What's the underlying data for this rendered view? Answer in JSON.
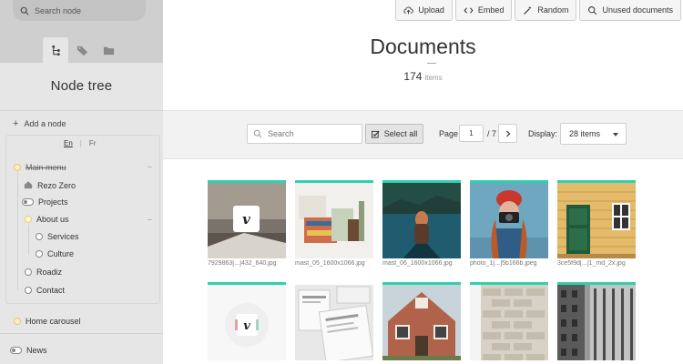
{
  "sidebar": {
    "search_placeholder": "Search node",
    "tabs": [
      {
        "icon": "node-tree-icon",
        "active": true
      },
      {
        "icon": "tag-icon",
        "active": false
      },
      {
        "icon": "folder-icon",
        "active": false
      }
    ],
    "title": "Node tree",
    "add_node": "Add a node",
    "languages": [
      "En",
      "Fr"
    ],
    "tree": {
      "main_menu": "Main menu",
      "rezo_zero": "Rezo Zero",
      "projects": "Projects",
      "about_us": "About us",
      "services": "Services",
      "culture": "Culture",
      "roadiz": "Roadiz",
      "contact": "Contact",
      "home_carousel": "Home carousel",
      "news": "News"
    }
  },
  "toolbar_top": {
    "upload": "Upload",
    "embed": "Embed",
    "random": "Random",
    "unused": "Unused documents"
  },
  "main": {
    "title": "Documents",
    "count": "174",
    "count_unit": "items"
  },
  "filters": {
    "search_placeholder": "Search",
    "select_all": "Select all",
    "page_label": "Page",
    "page_value": "1",
    "page_total": "/ 7",
    "display_label": "Display:",
    "display_value": "28 items"
  },
  "documents": [
    {
      "caption": "7929863[...]432_640.jpg",
      "selected": true
    },
    {
      "caption": "mast_05_1600x1066.jpg",
      "selected": true
    },
    {
      "caption": "mast_06_1600x1066.jpg",
      "selected": true
    },
    {
      "caption": "photo_1[...]5b166b.jpeg",
      "selected": true
    },
    {
      "caption": "3ce5f9d[...]1_md_2x.jpg",
      "selected": true
    },
    {
      "caption": "",
      "selected": true
    },
    {
      "caption": "",
      "selected": false
    },
    {
      "caption": "",
      "selected": true
    },
    {
      "caption": "",
      "selected": true
    },
    {
      "caption": "",
      "selected": true
    }
  ],
  "colors": {
    "accent": "#2fd0b0",
    "sidebar_bg": "#e6e6e6",
    "sidebar_top": "#cfcfcf"
  }
}
